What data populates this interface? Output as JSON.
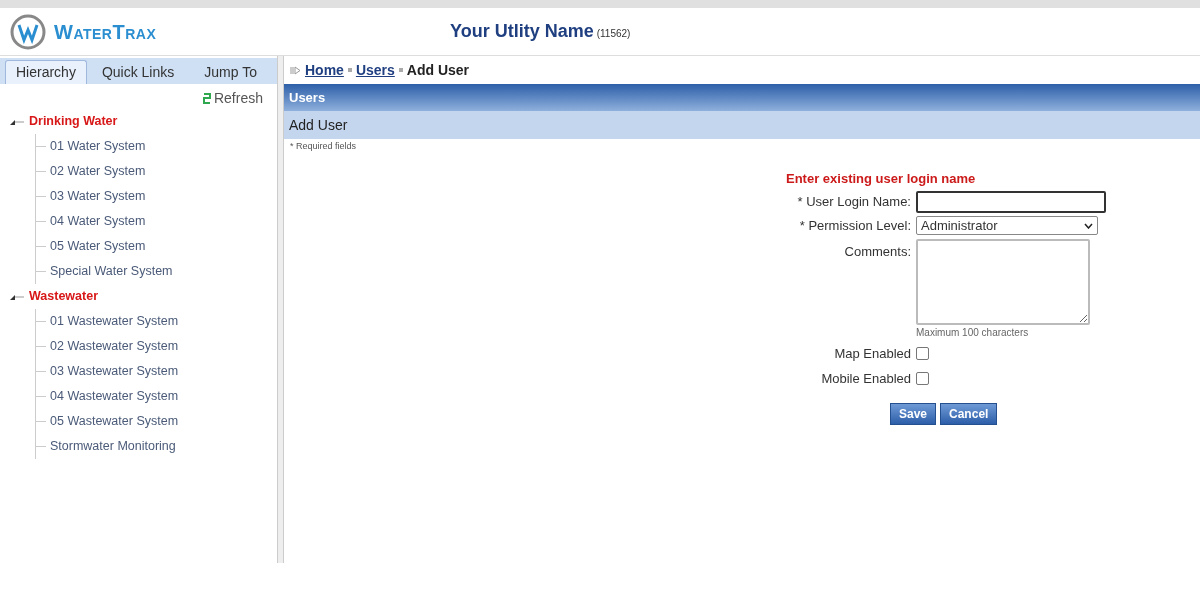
{
  "header": {
    "brand": "WaterTrax",
    "title": "Your Utlity Name",
    "account": "(11562)"
  },
  "sidebar": {
    "tabs": [
      {
        "label": "Hierarchy",
        "selected": true
      },
      {
        "label": "Quick Links",
        "selected": false
      },
      {
        "label": "Jump To",
        "selected": false
      }
    ],
    "refresh": "Refresh",
    "tree": [
      {
        "label": "Drinking Water",
        "expanded": true,
        "children": [
          {
            "label": "01 Water System"
          },
          {
            "label": "02 Water System"
          },
          {
            "label": "03 Water System"
          },
          {
            "label": "04 Water System"
          },
          {
            "label": "05 Water System"
          },
          {
            "label": "Special Water System"
          }
        ]
      },
      {
        "label": "Wastewater",
        "expanded": true,
        "children": [
          {
            "label": "01 Wastewater System"
          },
          {
            "label": "02 Wastewater System"
          },
          {
            "label": "03 Wastewater System"
          },
          {
            "label": "04 Wastewater System"
          },
          {
            "label": "05 Wastewater System"
          },
          {
            "label": "Stormwater Monitoring"
          }
        ]
      }
    ]
  },
  "breadcrumb": [
    {
      "label": "Home",
      "link": true
    },
    {
      "label": "Users",
      "link": true
    },
    {
      "label": "Add User",
      "link": false
    }
  ],
  "section_title": "Users",
  "subsection_title": "Add User",
  "required_note": "* Required fields",
  "form": {
    "heading": "Enter existing user login name",
    "login_label": "* User Login Name:",
    "permission_label": "* Permission Level:",
    "permission_value": "Administrator",
    "comments_label": "Comments:",
    "comments_hint": "Maximum 100 characters",
    "checkboxes": [
      {
        "label": "Map Enabled",
        "checked": false
      },
      {
        "label": "Mobile Enabled",
        "checked": false
      }
    ],
    "buttons": [
      "Save",
      "Cancel"
    ]
  }
}
